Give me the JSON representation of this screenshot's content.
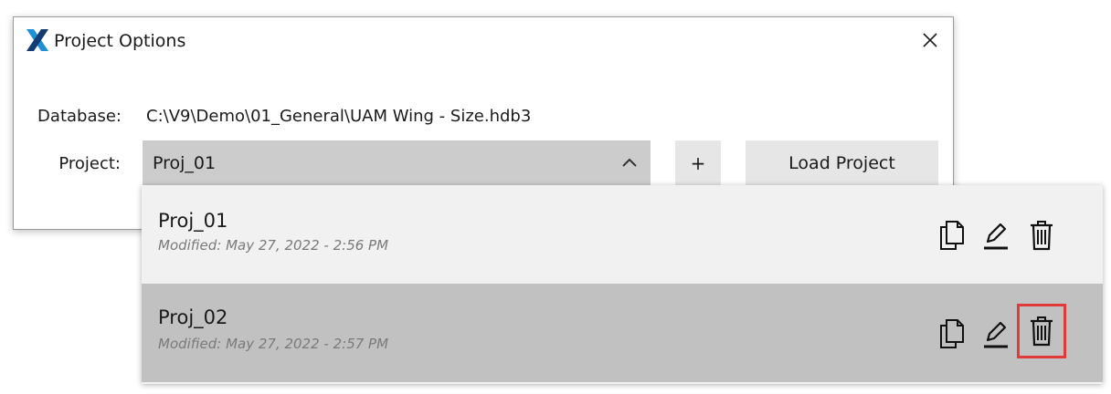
{
  "dialog": {
    "title": "Project Options",
    "database_label": "Database:",
    "database_value": "C:\\V9\\Demo\\01_General\\UAM Wing - Size.hdb3",
    "project_label": "Project:",
    "project_selected": "Proj_01",
    "add_label": "+",
    "load_label": "Load Project"
  },
  "dropdown": {
    "items": [
      {
        "name": "Proj_01",
        "modified": "Modified: May 27, 2022 - 2:56 PM"
      },
      {
        "name": "Proj_02",
        "modified": "Modified: May 27, 2022 - 2:57 PM"
      }
    ]
  },
  "colors": {
    "accent_logo": "#1e90d6",
    "highlight_border": "#e03a3a"
  },
  "icons": [
    "app-logo-icon",
    "close-icon",
    "chevron-up-icon",
    "copy-icon",
    "edit-icon",
    "delete-icon"
  ]
}
